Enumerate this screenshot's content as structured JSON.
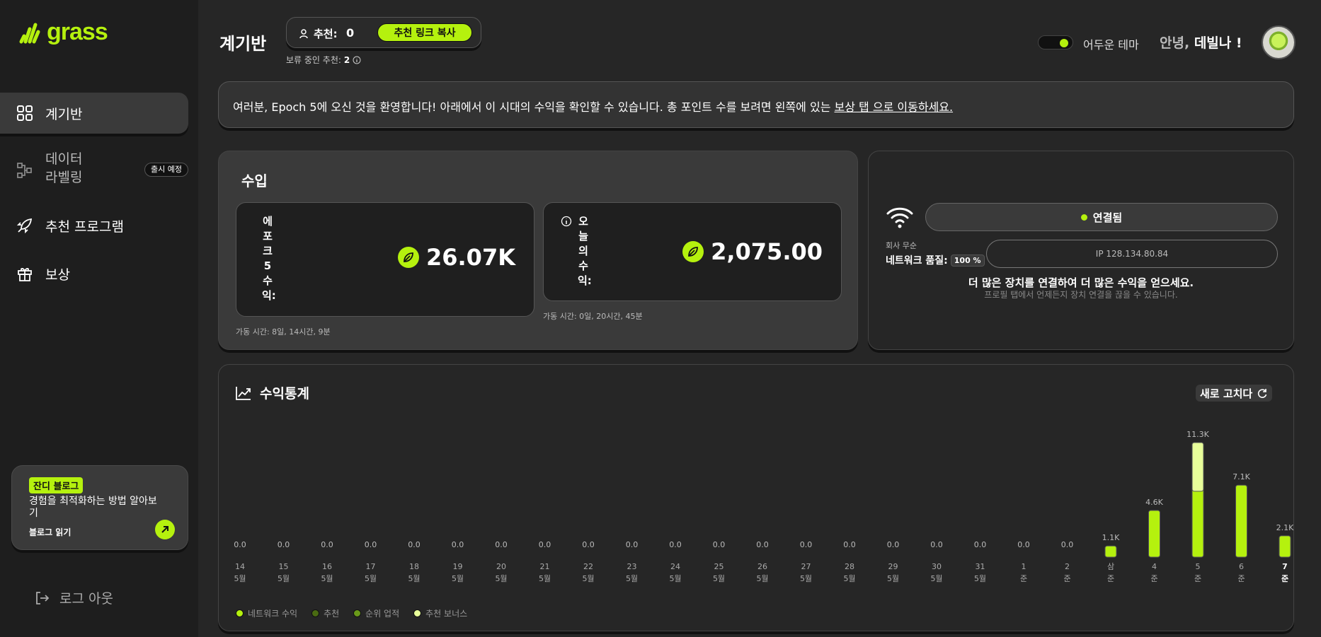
{
  "brand": {
    "name": "grass",
    "accent": "#b5f10e"
  },
  "sidebar": {
    "items": [
      {
        "label": "계기반",
        "icon": "grid-icon"
      },
      {
        "label": "데이터\n라벨링",
        "icon": "data-labeling-icon",
        "badge": "출시 예정"
      },
      {
        "label": "추천 프로그램",
        "icon": "rocket-icon"
      },
      {
        "label": "보상",
        "icon": "gift-icon"
      }
    ],
    "blog": {
      "tag": "잔디 블로그",
      "desc": "경험을 최적화하는 방법 알아보기",
      "read": "블로그 읽기"
    },
    "logout": "로그 아웃"
  },
  "header": {
    "title": "계기반",
    "referral_label": "추천:",
    "referral_count": "0",
    "copy_link": "추천 링크 복사",
    "pending_label": "보류 중인 추천:",
    "pending_count": "2",
    "theme_label": "어두운 테마",
    "greeting_pre": "안녕,",
    "greeting_name": "데빌나 !"
  },
  "welcome": {
    "text": "여러분, Epoch 5에 오신 것을 환영합니다! 아래에서 이 시대의 수익을 확인할 수 있습니다. 총 포인트 수를 보려면 왼쪽에 있는 ",
    "link": "보상 탭 으로 이동하세요."
  },
  "earnings": {
    "title": "수입",
    "epoch_label": "에포크5수익:",
    "epoch_value": "26.07K",
    "epoch_uptime": "가동 시간: 8일, 14시간, 9분",
    "today_label": "오늘의수익:",
    "today_value": "2,075.00",
    "today_uptime": "가동 시간: 0일, 20시간, 45분"
  },
  "connection": {
    "status": "연결됨",
    "wireless_label": "회사 무순",
    "network_quality_label": "네트워크 품질:",
    "network_quality_value": "100 %",
    "ip": "IP 128.134.80.84",
    "more_devices": "더 많은 장치를 연결하여 더 많은 수익을 얻으세요.",
    "more_devices_sub": "프로필 탭에서 언제든지 장치 연결을 끊을 수 있습니다."
  },
  "stats": {
    "title": "수익통계",
    "refresh": "새로 고치다",
    "legend": [
      {
        "label": "네트워크 수익",
        "color": "#b5f10e"
      },
      {
        "label": "추천",
        "color": "#4a6b12"
      },
      {
        "label": "순위 업적",
        "color": "#6a9a1a"
      },
      {
        "label": "추천 보너스",
        "color": "#e8ff9a"
      }
    ]
  },
  "chart_data": {
    "type": "bar",
    "categories": [
      "14\n5월",
      "15\n5월",
      "16\n5월",
      "17\n5월",
      "18\n5월",
      "19\n5월",
      "20\n5월",
      "21\n5월",
      "22\n5월",
      "23\n5월",
      "24\n5월",
      "25\n5월",
      "26\n5월",
      "27\n5월",
      "28\n5월",
      "29\n5월",
      "30\n5월",
      "31\n5월",
      "1\n준",
      "2\n준",
      "삼\n준",
      "4\n준",
      "5\n준",
      "6\n준",
      "7\n준"
    ],
    "value_labels": [
      "0.0",
      "0.0",
      "0.0",
      "0.0",
      "0.0",
      "0.0",
      "0.0",
      "0.0",
      "0.0",
      "0.0",
      "0.0",
      "0.0",
      "0.0",
      "0.0",
      "0.0",
      "0.0",
      "0.0",
      "0.0",
      "0.0",
      "0.0",
      "1.1K",
      "4.6K",
      "11.3K",
      "7.1K",
      "2.1K"
    ],
    "values": [
      0,
      0,
      0,
      0,
      0,
      0,
      0,
      0,
      0,
      0,
      0,
      0,
      0,
      0,
      0,
      0,
      0,
      0,
      0,
      0,
      1100,
      4600,
      11300,
      7100,
      2100
    ],
    "bonus": [
      0,
      0,
      0,
      0,
      0,
      0,
      0,
      0,
      0,
      0,
      0,
      0,
      0,
      0,
      0,
      0,
      0,
      0,
      0,
      0,
      0,
      0,
      4800,
      0,
      0
    ],
    "ylim": [
      0,
      11300
    ]
  }
}
